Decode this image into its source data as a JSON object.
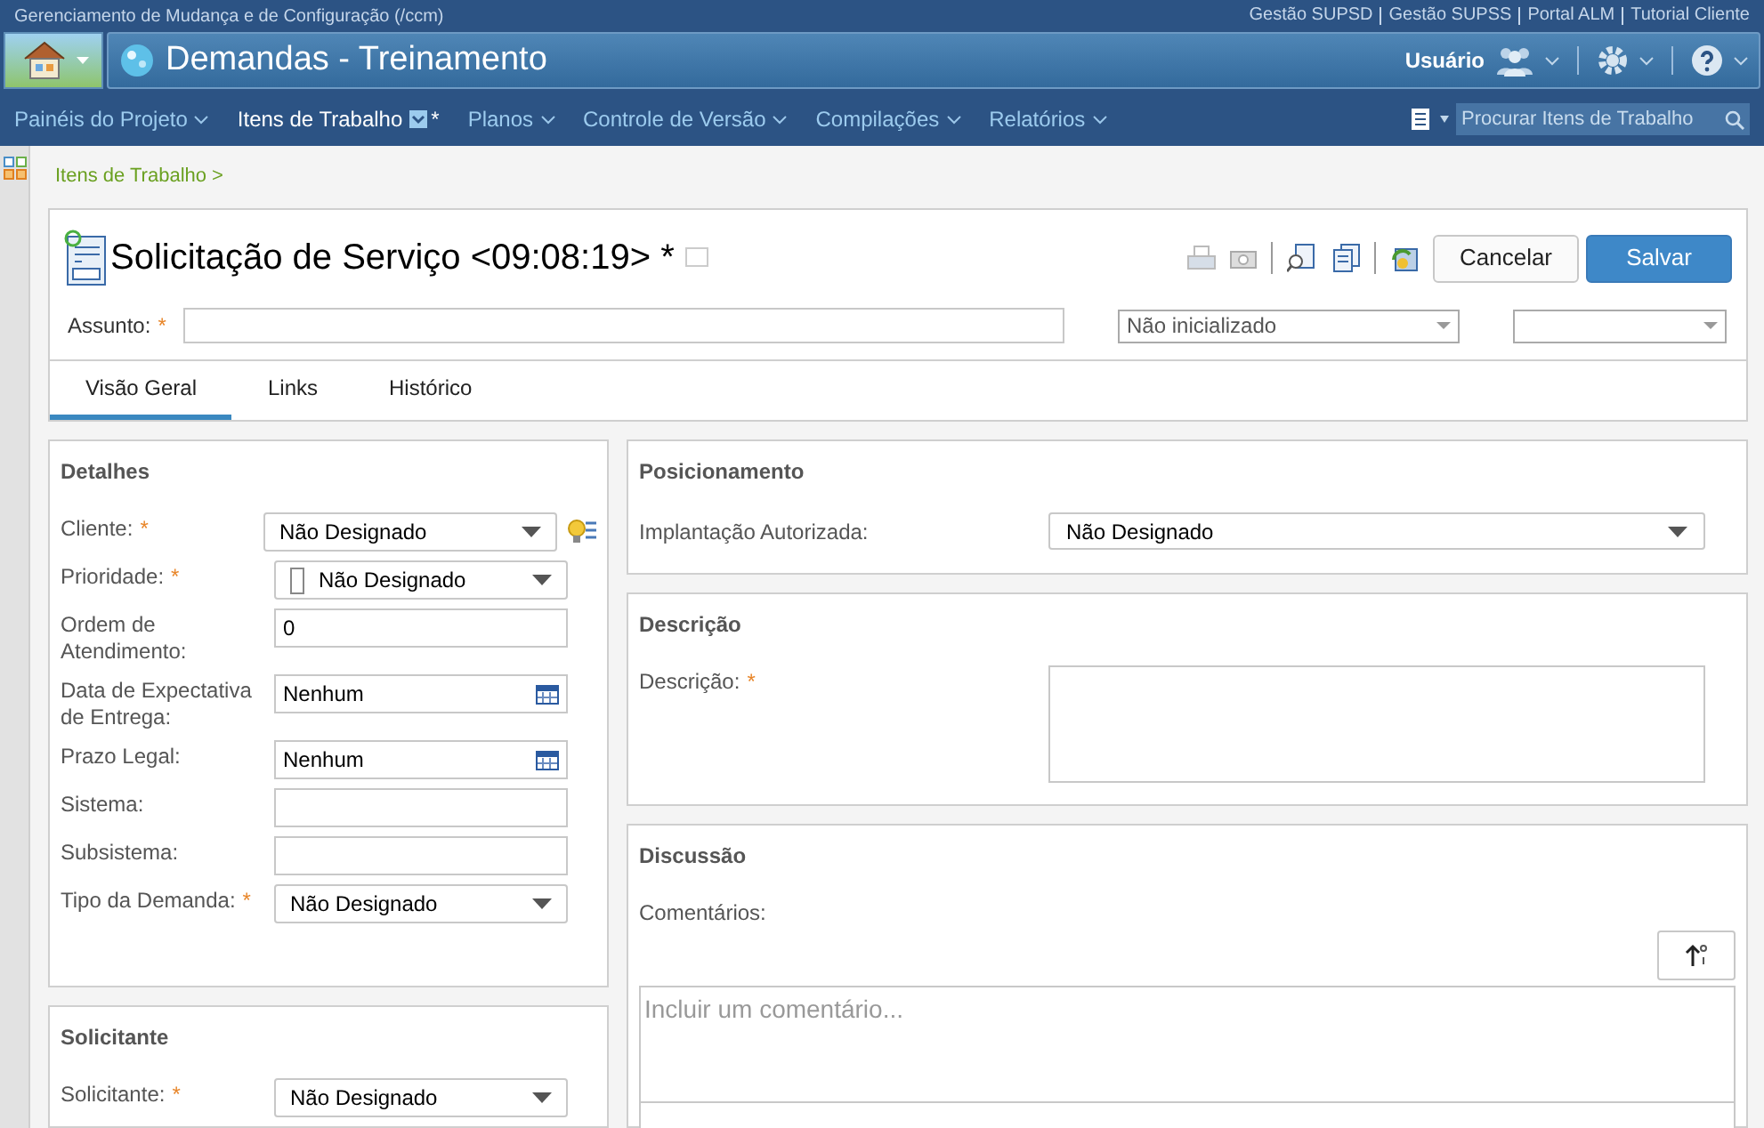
{
  "app_title": "Gerenciamento de Mudança e de Configuração (/ccm)",
  "top_links": [
    "Gestão SUPSD",
    "Gestão SUPSS",
    "Portal ALM",
    "Tutorial Cliente"
  ],
  "project_title": "Demandas - Treinamento",
  "user_label": "Usuário",
  "nav": [
    {
      "label": "Painéis do Projeto",
      "selected": false
    },
    {
      "label": "Itens de Trabalho",
      "selected": true,
      "mark": "*"
    },
    {
      "label": "Planos",
      "selected": false
    },
    {
      "label": "Controle de Versão",
      "selected": false
    },
    {
      "label": "Compilações",
      "selected": false
    },
    {
      "label": "Relatórios",
      "selected": false
    }
  ],
  "search": {
    "placeholder": "Procurar Itens de Trabalho"
  },
  "breadcrumb": "Itens de Trabalho >",
  "work_item": {
    "title": "Solicitação de Serviço <09:08:19> *",
    "buttons": [
      {
        "label": "Cancelar",
        "kind": "secondary"
      },
      {
        "label": "Salvar",
        "kind": "primary"
      }
    ],
    "subject_label": "Assunto:",
    "subject_required": true,
    "state": "Não inicializado"
  },
  "tabs": [
    {
      "label": "Visão Geral",
      "selected": true
    },
    {
      "label": "Links",
      "selected": false
    },
    {
      "label": "Histórico",
      "selected": false
    }
  ],
  "details": {
    "title": "Detalhes",
    "fields": [
      {
        "label": "Cliente:",
        "required": true,
        "kind": "lookup",
        "value": "Não Designado"
      },
      {
        "label": "Prioridade:",
        "required": true,
        "kind": "priority",
        "value": "Não Designado"
      },
      {
        "label": "Ordem de Atendimento:",
        "required": false,
        "kind": "text",
        "value": "0"
      },
      {
        "label": "Data de Expectativa de Entrega:",
        "required": false,
        "kind": "date",
        "value": "Nenhum"
      },
      {
        "label": "Prazo Legal:",
        "required": false,
        "kind": "date",
        "value": "Nenhum"
      },
      {
        "label": "Sistema:",
        "required": false,
        "kind": "text"
      },
      {
        "label": "Subsistema:",
        "required": false,
        "kind": "text"
      },
      {
        "label": "Tipo da Demanda:",
        "required": true,
        "kind": "select",
        "value": "Não Designado"
      }
    ]
  },
  "requester": {
    "title": "Solicitante",
    "fields": [
      {
        "label": "Solicitante:",
        "required": true,
        "kind": "select",
        "value": "Não Designado"
      }
    ]
  },
  "positioning": {
    "title": "Posicionamento",
    "label": "Implantação Autorizada:",
    "value": "Não Designado"
  },
  "description": {
    "title": "Descrição",
    "label": "Descrição:",
    "required": true
  },
  "discussion": {
    "title": "Discussão",
    "label": "Comentários:",
    "placeholder": "Incluir um comentário..."
  }
}
